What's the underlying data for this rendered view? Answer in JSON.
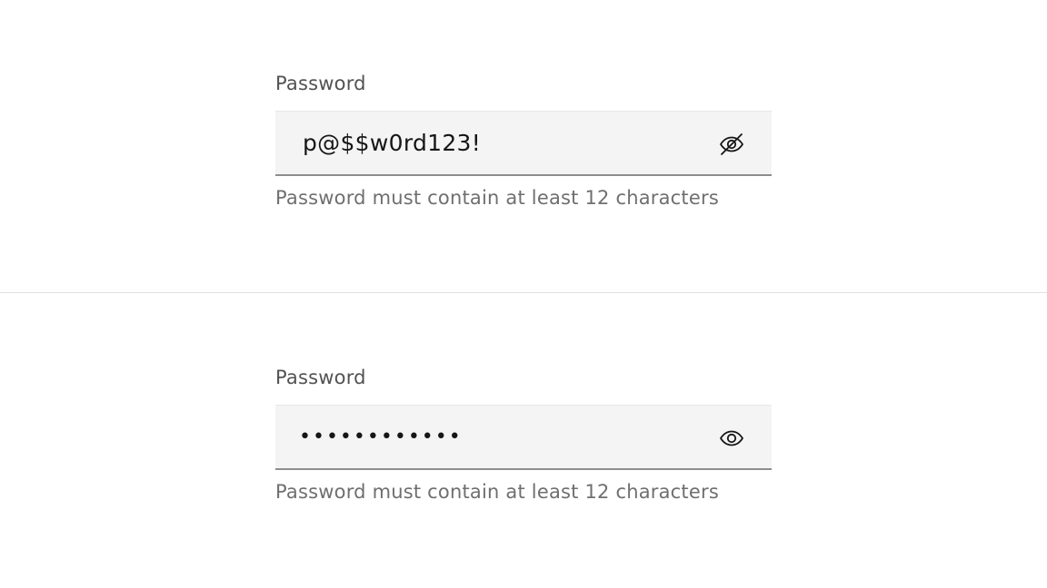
{
  "visible_field": {
    "label": "Password",
    "value": "p@$$w0rd123!",
    "toggle_icon": "eye-off-icon",
    "helper_text": "Password must contain at least 12 characters"
  },
  "masked_field": {
    "label": "Password",
    "value": "••••••••••••",
    "toggle_icon": "eye-icon",
    "helper_text": "Password must contain at least 12 characters"
  },
  "colors": {
    "field_background": "#f4f4f4",
    "field_border": "#8d8d8d",
    "label": "#525252",
    "helper": "#6f6f6f",
    "text": "#161616",
    "divider": "#e0e0e0"
  }
}
